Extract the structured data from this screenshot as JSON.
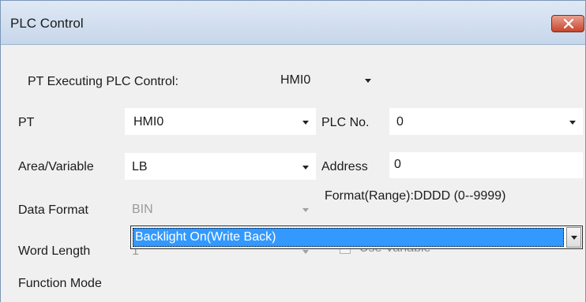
{
  "window": {
    "title": "PLC Control"
  },
  "pt_executing": {
    "label": "PT Executing PLC Control:",
    "value": "HMI0"
  },
  "pt": {
    "label": "PT",
    "value": "HMI0"
  },
  "plc_no": {
    "label": "PLC No.",
    "value": "0"
  },
  "area_variable": {
    "label": "Area/Variable",
    "value": "LB"
  },
  "address": {
    "label": "Address",
    "value": "0"
  },
  "format_range": {
    "text": "Format(Range):DDDD (0--9999)"
  },
  "data_format": {
    "label": "Data Format",
    "value": "BIN",
    "enabled": false
  },
  "word_length": {
    "label": "Word Length",
    "value": "1",
    "enabled": false
  },
  "use_variable": {
    "label": "Use Variable",
    "checked": false,
    "enabled": false
  },
  "function_mode": {
    "label": "Function Mode",
    "value": "Backlight On(Write Back)"
  },
  "colors": {
    "title_bar": "#c6d6ea",
    "selection": "#3399ff",
    "close_button": "#c7452d",
    "dialog_bg": "#f0f0f0"
  }
}
